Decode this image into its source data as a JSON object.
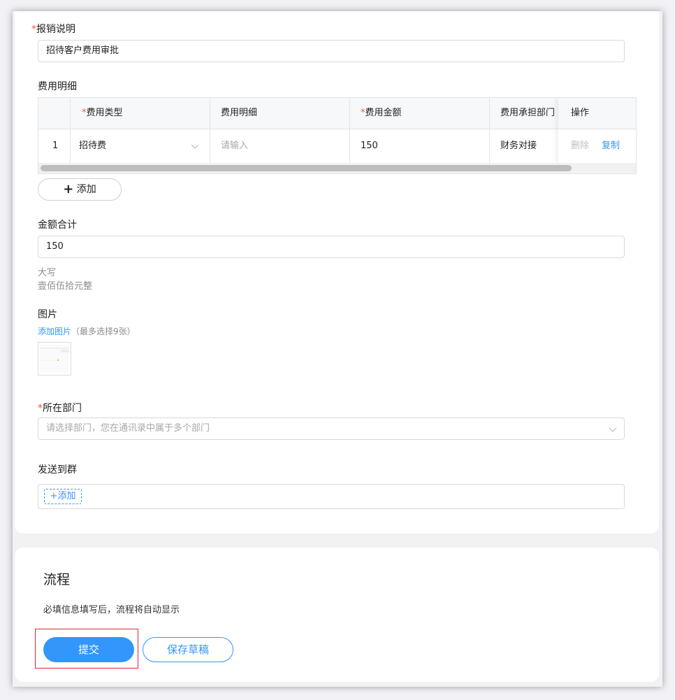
{
  "form": {
    "description_label": "报销说明",
    "description_value": "招待客户费用审批",
    "detail_label": "费用明细",
    "table": {
      "headers": [
        "费用类型",
        "费用明细",
        "费用金额",
        "费用承担部门",
        "操作"
      ],
      "rows": [
        {
          "index": "1",
          "type": "招待费",
          "detail_placeholder": "请输入",
          "amount": "150",
          "department": "财务对接",
          "delete_label": "删除",
          "copy_label": "复制"
        }
      ]
    },
    "add_row_label": "添加",
    "total_label": "金额合计",
    "total_value": "150",
    "uppercase_label": "大写",
    "uppercase_value": "壹佰伍拾元整",
    "image_label": "图片",
    "add_image_link": "添加图片",
    "add_image_hint": "（最多选择9张）",
    "dept_label": "所在部门",
    "dept_placeholder": "请选择部门，您在通讯录中属于多个部门",
    "group_label": "发送到群",
    "group_add_label": "+添加"
  },
  "process": {
    "title": "流程",
    "hint": "必填信息填写后，流程将自动显示",
    "submit_label": "提交",
    "draft_label": "保存草稿"
  },
  "colors": {
    "accent": "#3296fa",
    "required": "#f25643",
    "highlight": "#e0262b"
  }
}
